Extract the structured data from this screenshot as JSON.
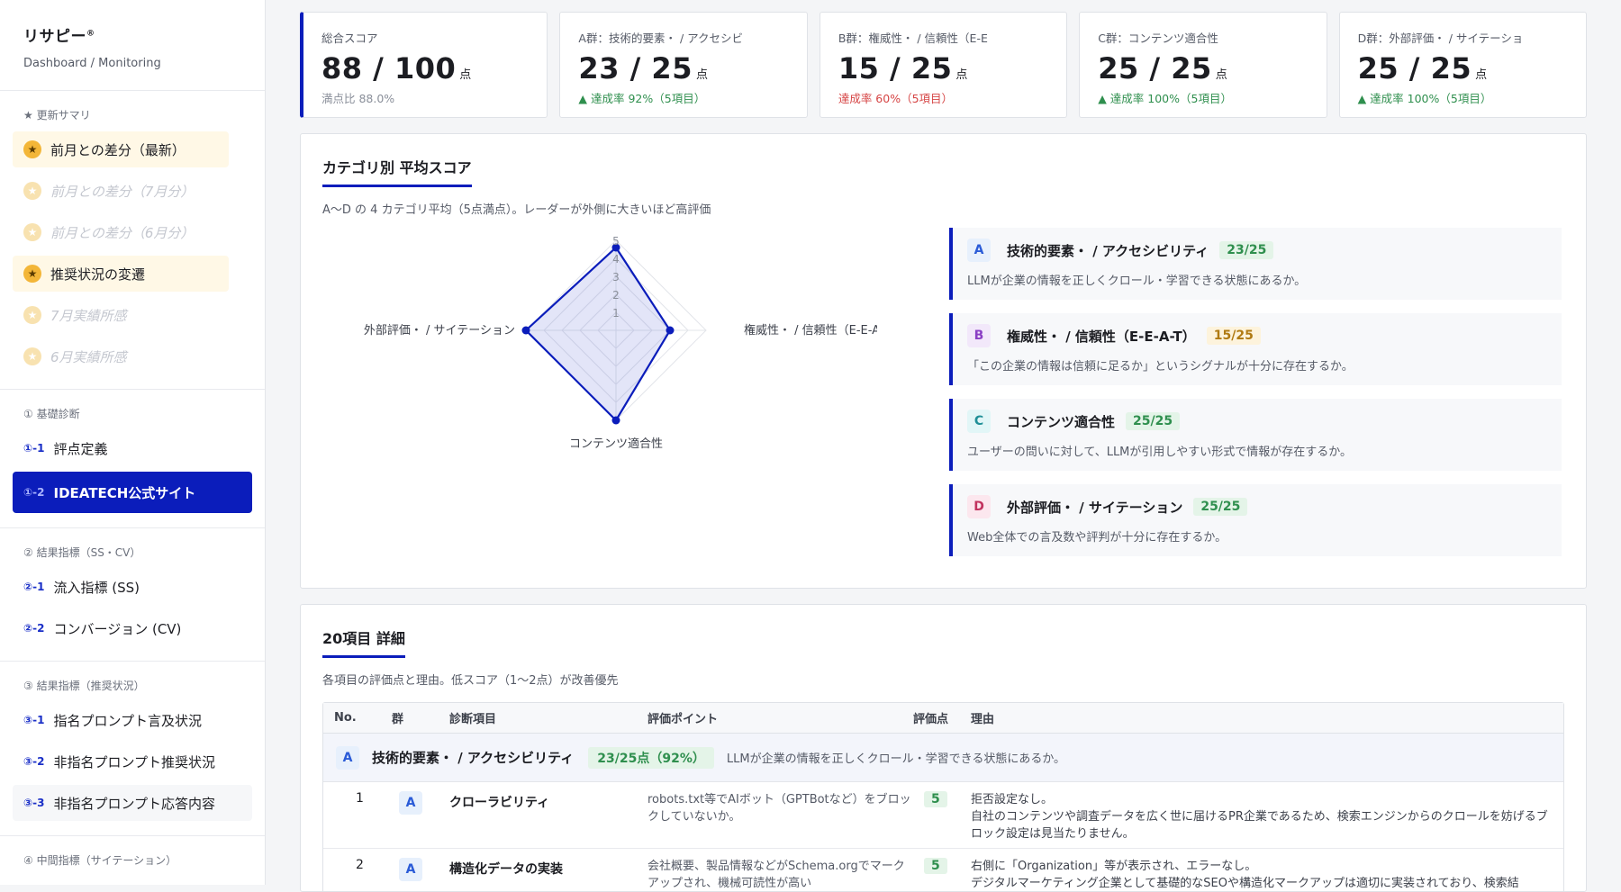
{
  "brand": {
    "title": "リサピー",
    "reg": "®",
    "subtitle": "Dashboard / Monitoring"
  },
  "sidebar": {
    "sections": [
      {
        "heading": "★ 更新サマリ",
        "items": [
          {
            "label": "前月との差分（最新）",
            "icon": "star-icon",
            "state": "active"
          },
          {
            "label": "前月との差分（7月分）",
            "icon": "star-icon",
            "state": "dim"
          },
          {
            "label": "前月との差分（6月分）",
            "icon": "star-icon",
            "state": "dim"
          },
          {
            "label": "推奨状況の変遷",
            "icon": "star-icon",
            "state": "active"
          },
          {
            "label": "7月実績所感",
            "icon": "star-icon",
            "state": "dim"
          },
          {
            "label": "6月実績所感",
            "icon": "star-icon",
            "state": "dim"
          }
        ]
      },
      {
        "heading": "① 基礎診断",
        "items": [
          {
            "code": "①-1",
            "label": "評点定義"
          },
          {
            "code": "①-2",
            "label": "IDEATECH公式サイト",
            "state": "selected"
          }
        ]
      },
      {
        "heading": "② 結果指標（SS・CV）",
        "items": [
          {
            "code": "②-1",
            "label": "流入指標 (SS)"
          },
          {
            "code": "②-2",
            "label": "コンバージョン (CV)"
          }
        ]
      },
      {
        "heading": "③ 結果指標（推奨状況）",
        "items": [
          {
            "code": "③-1",
            "label": "指名プロンプト言及状況"
          },
          {
            "code": "③-2",
            "label": "非指名プロンプト推奨状況"
          },
          {
            "code": "③-3",
            "label": "非指名プロンプト応答内容",
            "state": "soft"
          }
        ]
      },
      {
        "heading": "④ 中間指標（サイテーション）",
        "items": []
      }
    ]
  },
  "cards": [
    {
      "label": "総合スコア",
      "value": "88 / 100",
      "unit": "点",
      "foot": "満点比 88.0%",
      "tone": "gray"
    },
    {
      "label": "A群：技術的要素・ / アクセシビ",
      "value": "23 / 25",
      "unit": "点",
      "foot": "▲ 達成率 92%（5項目）",
      "tone": "green"
    },
    {
      "label": "B群：権威性・ / 信頼性（E-E",
      "value": "15 / 25",
      "unit": "点",
      "foot": "達成率 60%（5項目）",
      "tone": "red"
    },
    {
      "label": "C群：コンテンツ適合性",
      "value": "25 / 25",
      "unit": "点",
      "foot": "▲ 達成率 100%（5項目）",
      "tone": "green"
    },
    {
      "label": "D群：外部評価・ / サイテーショ",
      "value": "25 / 25",
      "unit": "点",
      "foot": "▲ 達成率 100%（5項目）",
      "tone": "green"
    }
  ],
  "radar": {
    "title": "カテゴリ別 平均スコア",
    "desc": "A〜D の 4 カテゴリ平均（5点満点）。レーダーが外側に大きいほど高評価",
    "axes": [
      "技術的要素・ / アクセシビリティ",
      "権威性・ / 信頼性（E-E-A-T）",
      "コンテンツ適合性",
      "外部評価・ / サイテーション"
    ],
    "ticks": [
      "1",
      "2",
      "3",
      "4",
      "5"
    ],
    "max": 5,
    "values": [
      4.6,
      3.0,
      5.0,
      5.0
    ],
    "color": "#0b1dbb"
  },
  "categories": [
    {
      "letter": "A",
      "name": "技術的要素・ / アクセシビリティ",
      "score": "23/25",
      "desc": "LLMが企業の情報を正しくクロール・学習できる状態にあるか。",
      "letterBg": "#e7f0fc",
      "letterColor": "#2a5bd7",
      "scoreBg": "#e4f4e8",
      "scoreColor": "#2f8f4e"
    },
    {
      "letter": "B",
      "name": "権威性・ / 信頼性（E-E-A-T）",
      "score": "15/25",
      "desc": "「この企業の情報は信頼に足るか」というシグナルが十分に存在するか。",
      "letterBg": "#f2e8fa",
      "letterColor": "#8a3fc4",
      "scoreBg": "#fdf3dc",
      "scoreColor": "#b07a12"
    },
    {
      "letter": "C",
      "name": "コンテンツ適合性",
      "score": "25/25",
      "desc": "ユーザーの問いに対して、LLMが引用しやすい形式で情報が存在するか。",
      "letterBg": "#e2f6f7",
      "letterColor": "#1f8f97",
      "scoreBg": "#e4f4e8",
      "scoreColor": "#2f8f4e"
    },
    {
      "letter": "D",
      "name": "外部評価・ / サイテーション",
      "score": "25/25",
      "desc": "Web全体での言及数や評判が十分に存在するか。",
      "letterBg": "#fce7ee",
      "letterColor": "#c2335f",
      "scoreBg": "#e4f4e8",
      "scoreColor": "#2f8f4e"
    }
  ],
  "detail": {
    "title": "20項目 詳細",
    "desc": "各項目の評価点と理由。低スコア（1〜2点）が改善優先",
    "headers": {
      "no": "No.",
      "group": "群",
      "item": "診断項目",
      "point": "評価ポイント",
      "score": "評価点",
      "reason": "理由"
    },
    "group": {
      "letter": "A",
      "name": "技術的要素・ / アクセシビリティ",
      "score": "23/25点（92%）",
      "desc": "LLMが企業の情報を正しくクロール・学習できる状態にあるか。"
    },
    "rows": [
      {
        "no": "1",
        "group": "A",
        "item": "クローラビリティ",
        "point": "robots.txt等でAIボット（GPTBotなど）をブロックしていないか。",
        "score": "5",
        "reason": "拒否設定なし。\n自社のコンテンツや調査データを広く世に届けるPR企業であるため、検索エンジンからのクロールを妨げるブロック設定は見当たりません。"
      },
      {
        "no": "2",
        "group": "A",
        "item": "構造化データの実装",
        "point": "会社概要、製品情報などがSchema.orgでマークアップされ、機械可読性が高い",
        "score": "5",
        "reason": "右側に「Organization」等が表示され、エラーなし。\nデジタルマーケティング企業として基礎的なSEOや構造化マークアップは適切に実装されており、検索結"
      }
    ]
  }
}
